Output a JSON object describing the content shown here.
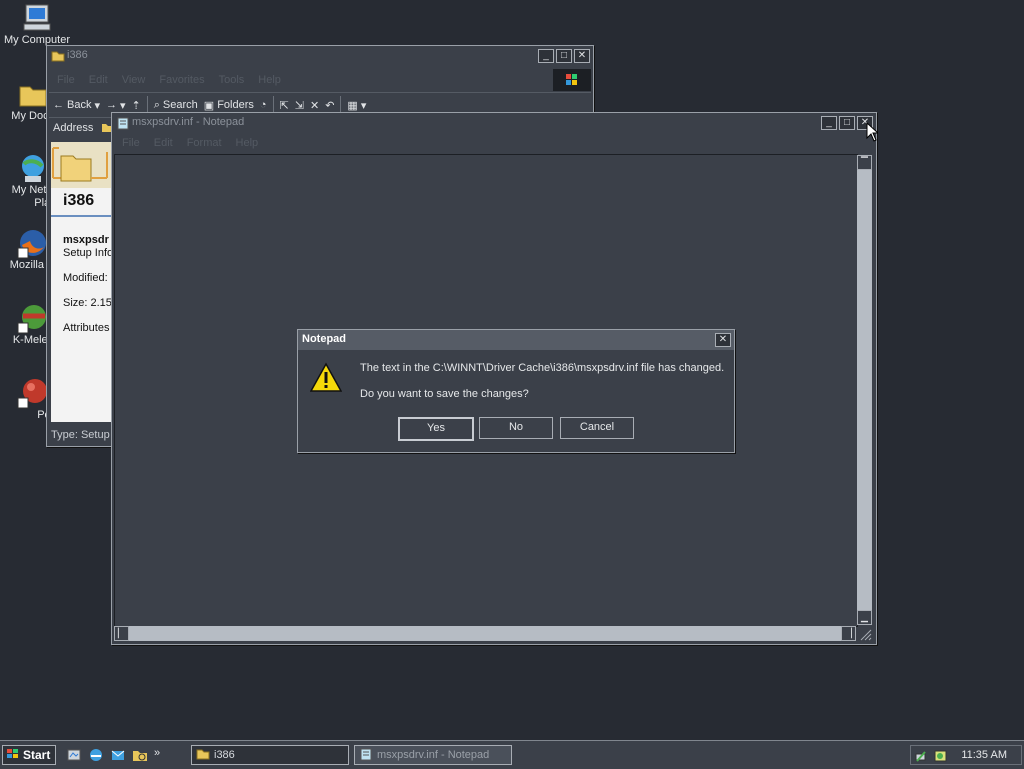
{
  "desktop": {
    "icons": [
      {
        "label": "My Computer",
        "icon": "computer-icon"
      },
      {
        "label": "My Docu",
        "icon": "folder-icon"
      },
      {
        "label": "My Netw",
        "label2": "Place",
        "icon": "network-icon"
      },
      {
        "label": "Mozilla Fi",
        "icon": "firefox-icon"
      },
      {
        "label": "K-Melec",
        "icon": "k-meleon-icon"
      },
      {
        "label": "Peg",
        "icon": "pegasus-icon"
      }
    ]
  },
  "explorer": {
    "title": "i386",
    "menu": [
      "File",
      "Edit",
      "View",
      "Favorites",
      "Tools",
      "Help"
    ],
    "toolbar": {
      "back": "Back",
      "search": "Search",
      "folders": "Folders"
    },
    "address_label": "Address",
    "panel_title": "i386",
    "file_name": "msxpsdr",
    "file_type": "Setup Info",
    "modified": "Modified: (",
    "size": "Size: 2.15",
    "attributes": "Attributes",
    "status": "Type: Setup"
  },
  "notepad": {
    "title": "msxpsdrv.inf - Notepad",
    "menu": [
      "File",
      "Edit",
      "Format",
      "Help"
    ]
  },
  "dialog": {
    "title": "Notepad",
    "message": "The text in the C:\\WINNT\\Driver Cache\\i386\\msxpsdrv.inf file has changed.",
    "question": "Do you want to save the changes?",
    "yes": "Yes",
    "no": "No",
    "cancel": "Cancel"
  },
  "taskbar": {
    "start": "Start",
    "tasks": [
      {
        "label": "i386"
      },
      {
        "label": "msxpsdrv.inf - Notepad"
      }
    ],
    "clock": "11:35 AM"
  },
  "colors": {
    "desktop": "#272b33",
    "window": "#3b4049",
    "dialog_title": "#565c66",
    "warning": "#f5d90a"
  }
}
